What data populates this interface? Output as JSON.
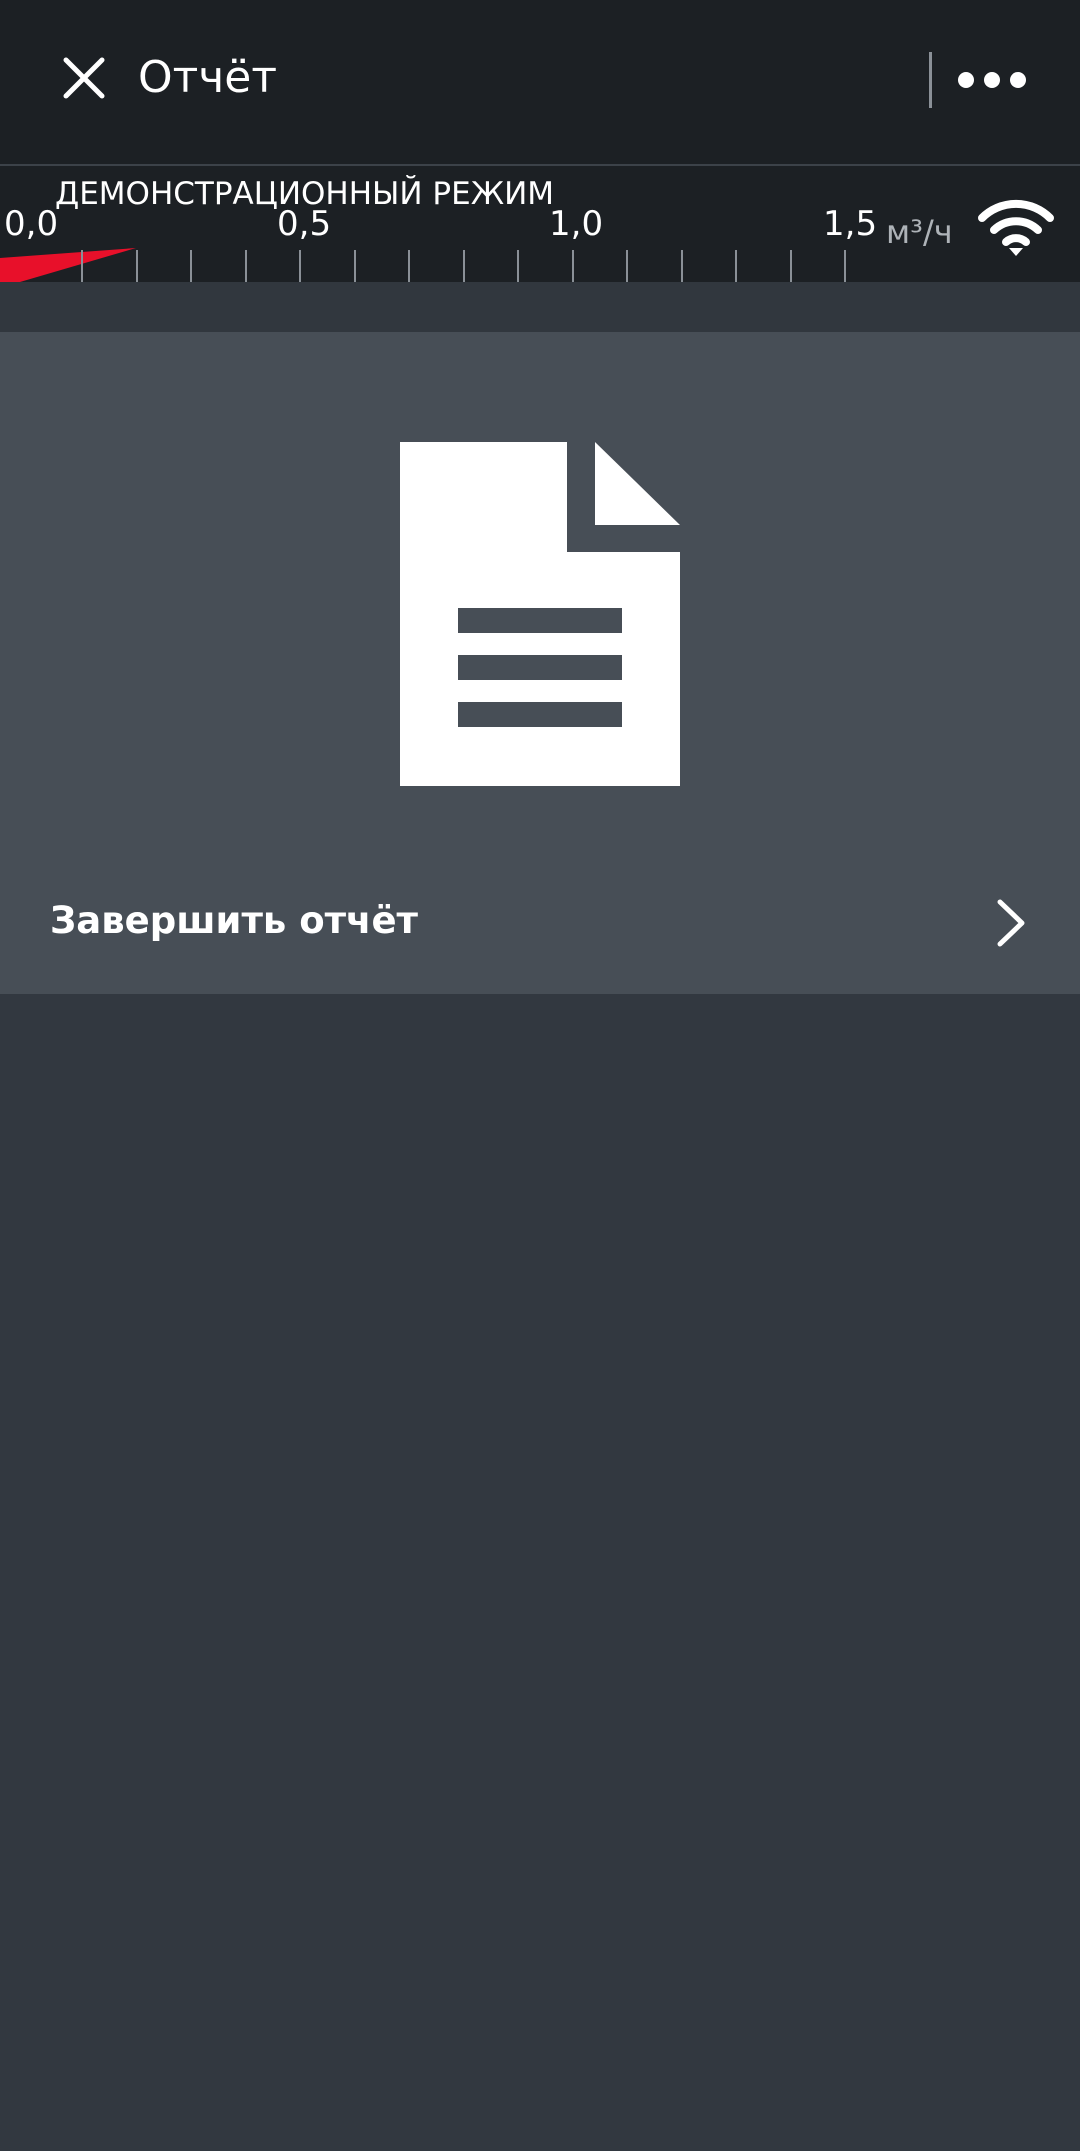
{
  "header": {
    "title": "Отчёт",
    "close_icon": "close-icon",
    "more_icon": "more-horizontal-icon"
  },
  "gauge": {
    "mode_label": "ДЕМОНСТРАЦИОННЫЙ РЕЖИМ",
    "scale_labels": [
      "0,0",
      "0,5",
      "1,0",
      "1,5"
    ],
    "unit": "м³/ч",
    "indicator_color": "#e8102a",
    "connection_icon": "wifi-icon"
  },
  "report": {
    "icon": "document-icon",
    "finish_label": "Завершить отчёт",
    "finish_icon": "chevron-right-icon"
  },
  "colors": {
    "app_bar": "#1c2024",
    "card": "#474e56",
    "background": "#323840",
    "accent": "#e8102a"
  }
}
